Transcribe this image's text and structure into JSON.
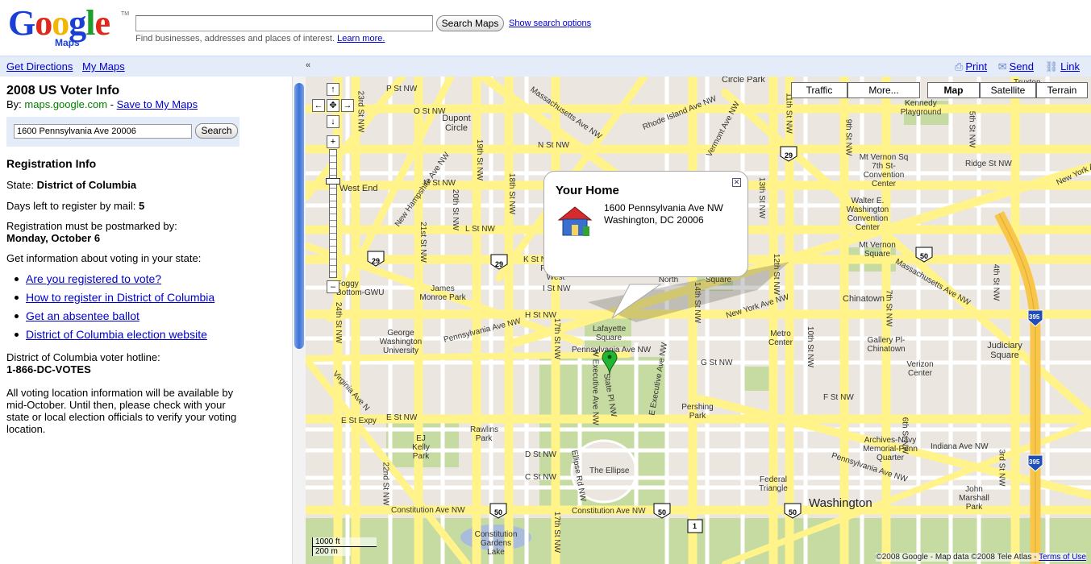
{
  "header": {
    "logo_text": "Google",
    "logo_sub": "Maps",
    "search_value": "",
    "search_button": "Search Maps",
    "search_options_link": "Show search options",
    "hint_text": "Find businesses, addresses and places of interest.",
    "learn_more": "Learn more."
  },
  "toolbar": {
    "get_directions": "Get Directions",
    "my_maps": "My Maps",
    "print": "Print",
    "send": "Send",
    "link": "Link"
  },
  "panel": {
    "title": "2008 US Voter Info",
    "by_prefix": "By:",
    "by_source": "maps.google.com",
    "by_sep": "-",
    "save_link": "Save to My Maps",
    "address_value": "1600 Pennsylvania Ave 20006",
    "search_button": "Search",
    "section_heading": "Registration Info",
    "state_label": "State:",
    "state_value": "District of Columbia",
    "days_label": "Days left to register by mail:",
    "days_value": "5",
    "postmark_label": "Registration must be postmarked by:",
    "postmark_value": "Monday, October 6",
    "info_text": "Get information about voting in your state:",
    "links": [
      "Are you registered to vote?",
      "How to register in District of Columbia",
      "Get an absentee ballot",
      "District of Columbia election website"
    ],
    "hotline_label": "District of Columbia voter hotline:",
    "hotline_value": "1-866-DC-VOTES",
    "footer_note": "All voting location information will be available by mid-October. Until then, please check with your state or local election officials to verify your voting location."
  },
  "map": {
    "type_buttons": [
      "Traffic",
      "More...",
      "Map",
      "Satellite",
      "Terrain"
    ],
    "selected_type": "Map",
    "infowindow": {
      "title": "Your Home",
      "line1": "1600 Pennsylvania Ave NW",
      "line2": "Washington, DC 20006"
    },
    "scale_ft": "1000 ft",
    "scale_m": "200 m",
    "copyright": "©2008 Google - Map data ©2008 Tele Atlas -",
    "terms_link": "Terms of Use",
    "street_labels": [
      "Massachusetts Ave NW",
      "Rhode Island Ave NW",
      "P St NW",
      "O St NW",
      "N St NW",
      "M St NW",
      "L St NW",
      "K St NW",
      "I St NW",
      "H St NW",
      "G St NW",
      "F St NW",
      "E St NW",
      "D St NW",
      "C St NW",
      "Constitution Ave NW",
      "Pennsylvania Ave NW",
      "New York Ave NW",
      "New Hampshire Ave NW",
      "Virginia Ave N",
      "E St Expy",
      "Indiana Ave NW",
      "Vermont Ave NW",
      "17th St NW",
      "18th St NW",
      "19th St NW",
      "20th St NW",
      "21st St NW",
      "22nd St NW",
      "23rd St NW",
      "24th St NW",
      "14th St NW",
      "13th St NW",
      "12th St NW",
      "11th St NW",
      "10th St NW",
      "9th St NW",
      "7th St NW",
      "6th St NW",
      "5th St NW",
      "4th St NW",
      "3rd St NW",
      "Ellipse Rd NW",
      "W Executive Ave NW",
      "E Executive Ave NW",
      "State Pl NW"
    ],
    "place_labels": [
      "Circle Park",
      "Dupont Circle",
      "West End",
      "Foggy Bottom-GWU",
      "James Monroe Park",
      "Farragut West",
      "Farragut North",
      "Franklin Square",
      "George Washington University",
      "Lafayette Square",
      "Pershing Park",
      "The Ellipse",
      "Rawlins Park",
      "EJ Kelly Park",
      "Constitution Gardens Lake",
      "Federal Triangle",
      "Washington",
      "Chinatown",
      "Metro Center",
      "Gallery Pl-Chinatown",
      "Verizon Center",
      "Mt Vernon Sq 7th St-Convention Center",
      "Walter E. Washington Convention Center",
      "Mt Vernon Square",
      "Kennedy Playground",
      "Judiciary Square",
      "Archives-Navy Memorial-Penn Quarter",
      "John Marshall Park",
      "Truxton",
      "Ridge St NW"
    ],
    "route_shields": [
      "29",
      "50",
      "1",
      "395"
    ],
    "colors": {
      "land": "#ebe7e0",
      "street": "#ffffff",
      "arterial": "#fff38a",
      "freeway": "#f7c64a",
      "park": "#c6dba1",
      "water": "#a9bcdb"
    }
  }
}
